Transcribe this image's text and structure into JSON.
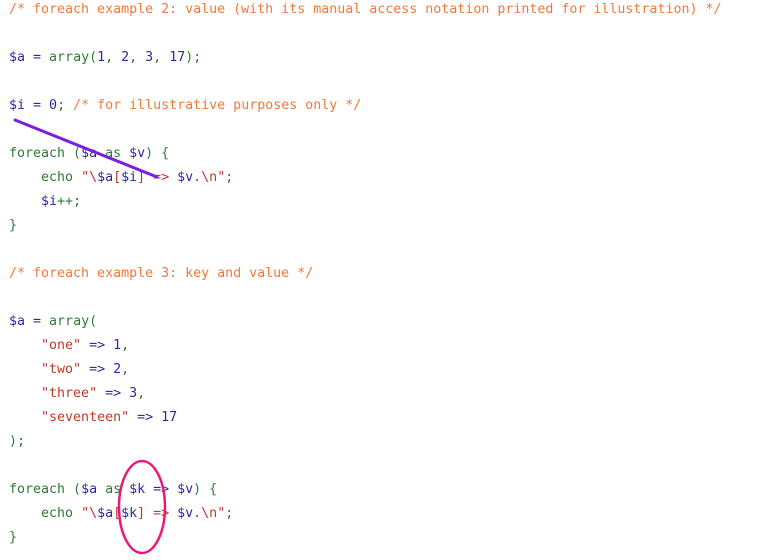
{
  "code_lines": [
    [
      {
        "t": "/* foreach example 2: value (with its manual access notation printed for illustration) */",
        "c": "comment"
      }
    ],
    [],
    [
      {
        "t": "$a",
        "c": "var"
      },
      {
        "t": " = ",
        "c": "op"
      },
      {
        "t": "array(",
        "c": "plain"
      },
      {
        "t": "1",
        "c": "num"
      },
      {
        "t": ", ",
        "c": "plain"
      },
      {
        "t": "2",
        "c": "num"
      },
      {
        "t": ", ",
        "c": "plain"
      },
      {
        "t": "3",
        "c": "num"
      },
      {
        "t": ", ",
        "c": "plain"
      },
      {
        "t": "17",
        "c": "num"
      },
      {
        "t": ");",
        "c": "plain"
      }
    ],
    [],
    [
      {
        "t": "$i",
        "c": "var"
      },
      {
        "t": " = ",
        "c": "op"
      },
      {
        "t": "0",
        "c": "num"
      },
      {
        "t": "; ",
        "c": "plain"
      },
      {
        "t": "/* for illustrative purposes only */",
        "c": "comment"
      }
    ],
    [],
    [
      {
        "t": "foreach (",
        "c": "plain"
      },
      {
        "t": "$a",
        "c": "var"
      },
      {
        "t": " as ",
        "c": "plain"
      },
      {
        "t": "$v",
        "c": "var"
      },
      {
        "t": ") {",
        "c": "plain"
      }
    ],
    [
      {
        "t": "    echo ",
        "c": "plain"
      },
      {
        "t": "\"\\",
        "c": "str"
      },
      {
        "t": "$a",
        "c": "var"
      },
      {
        "t": "[",
        "c": "str"
      },
      {
        "t": "$i",
        "c": "var"
      },
      {
        "t": "] => ",
        "c": "str"
      },
      {
        "t": "$v",
        "c": "var"
      },
      {
        "t": ".\\n\"",
        "c": "str"
      },
      {
        "t": ";",
        "c": "plain"
      }
    ],
    [
      {
        "t": "    ",
        "c": "plain"
      },
      {
        "t": "$i",
        "c": "var"
      },
      {
        "t": "++;",
        "c": "plain"
      }
    ],
    [
      {
        "t": "}",
        "c": "plain"
      }
    ],
    [],
    [
      {
        "t": "/* foreach example 3: key and value */",
        "c": "comment"
      }
    ],
    [],
    [
      {
        "t": "$a",
        "c": "var"
      },
      {
        "t": " = ",
        "c": "op"
      },
      {
        "t": "array(",
        "c": "plain"
      }
    ],
    [
      {
        "t": "    ",
        "c": "plain"
      },
      {
        "t": "\"one\"",
        "c": "str"
      },
      {
        "t": " => ",
        "c": "op"
      },
      {
        "t": "1",
        "c": "num"
      },
      {
        "t": ",",
        "c": "plain"
      }
    ],
    [
      {
        "t": "    ",
        "c": "plain"
      },
      {
        "t": "\"two\"",
        "c": "str"
      },
      {
        "t": " => ",
        "c": "op"
      },
      {
        "t": "2",
        "c": "num"
      },
      {
        "t": ",",
        "c": "plain"
      }
    ],
    [
      {
        "t": "    ",
        "c": "plain"
      },
      {
        "t": "\"three\"",
        "c": "str"
      },
      {
        "t": " => ",
        "c": "op"
      },
      {
        "t": "3",
        "c": "num"
      },
      {
        "t": ",",
        "c": "plain"
      }
    ],
    [
      {
        "t": "    ",
        "c": "plain"
      },
      {
        "t": "\"seventeen\"",
        "c": "str"
      },
      {
        "t": " => ",
        "c": "op"
      },
      {
        "t": "17",
        "c": "num"
      }
    ],
    [
      {
        "t": ");",
        "c": "plain"
      }
    ],
    [],
    [
      {
        "t": "foreach (",
        "c": "plain"
      },
      {
        "t": "$a",
        "c": "var"
      },
      {
        "t": " as ",
        "c": "plain"
      },
      {
        "t": "$k",
        "c": "var"
      },
      {
        "t": " => ",
        "c": "op"
      },
      {
        "t": "$v",
        "c": "var"
      },
      {
        "t": ") {",
        "c": "plain"
      }
    ],
    [
      {
        "t": "    echo ",
        "c": "plain"
      },
      {
        "t": "\"\\",
        "c": "str"
      },
      {
        "t": "$a",
        "c": "var"
      },
      {
        "t": "[",
        "c": "str"
      },
      {
        "t": "$k",
        "c": "var"
      },
      {
        "t": "] => ",
        "c": "str"
      },
      {
        "t": "$v",
        "c": "var"
      },
      {
        "t": ".\\n\"",
        "c": "str"
      },
      {
        "t": ";",
        "c": "plain"
      }
    ],
    [
      {
        "t": "}",
        "c": "plain"
      }
    ]
  ],
  "colors": {
    "comment": "#f07a3a",
    "variable": "#2a2aa0",
    "string": "#c0392b",
    "keyword": "#2e7d32",
    "strike_annotation": "#7a1fe0",
    "circle_annotation": "#e8197a"
  },
  "annotations": {
    "strike_icon": "strike-through-line",
    "circle_icon": "highlight-ellipse"
  }
}
